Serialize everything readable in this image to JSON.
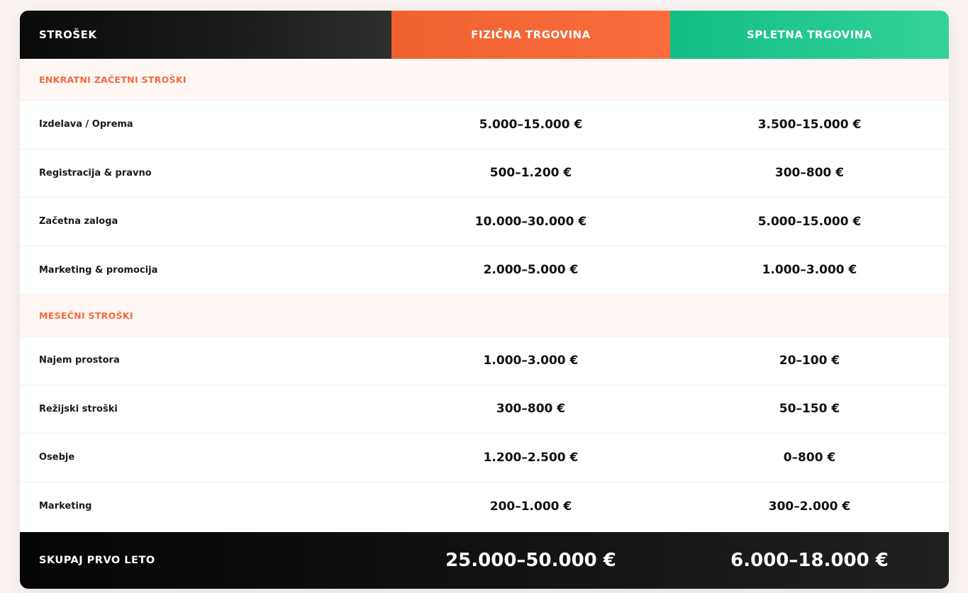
{
  "header": {
    "label": "STROŠEK",
    "physical": "FIZIČNA TRGOVINA",
    "online": "SPLETNA TRGOVINA"
  },
  "sections": [
    {
      "title": "ENKRATNI ZAČETNI STROŠKI",
      "rows": [
        {
          "label": "Izdelava / Oprema",
          "physical": "5.000–15.000 €",
          "online": "3.500–15.000 €"
        },
        {
          "label": "Registracija & pravno",
          "physical": "500–1.200 €",
          "online": "300–800 €"
        },
        {
          "label": "Začetna zaloga",
          "physical": "10.000–30.000 €",
          "online": "5.000–15.000 €"
        },
        {
          "label": "Marketing & promocija",
          "physical": "2.000–5.000 €",
          "online": "1.000–3.000 €"
        }
      ]
    },
    {
      "title": "MESEČNI STROŠKI",
      "rows": [
        {
          "label": "Najem prostora",
          "physical": "1.000–3.000 €",
          "online": "20–100 €"
        },
        {
          "label": "Režijski stroški",
          "physical": "300–800 €",
          "online": "50–150 €"
        },
        {
          "label": "Osebje",
          "physical": "1.200–2.500 €",
          "online": "0–800 €"
        },
        {
          "label": "Marketing",
          "physical": "200–1.000 €",
          "online": "300–2.000 €"
        }
      ]
    }
  ],
  "total": {
    "label": "SKUPAJ PRVO LETO",
    "physical": "25.000–50.000 €",
    "online": "6.000–18.000 €"
  },
  "colors": {
    "physical_accent": "#F26A3D",
    "online_accent": "#1BC58C",
    "dark": "#0A0A0A"
  }
}
